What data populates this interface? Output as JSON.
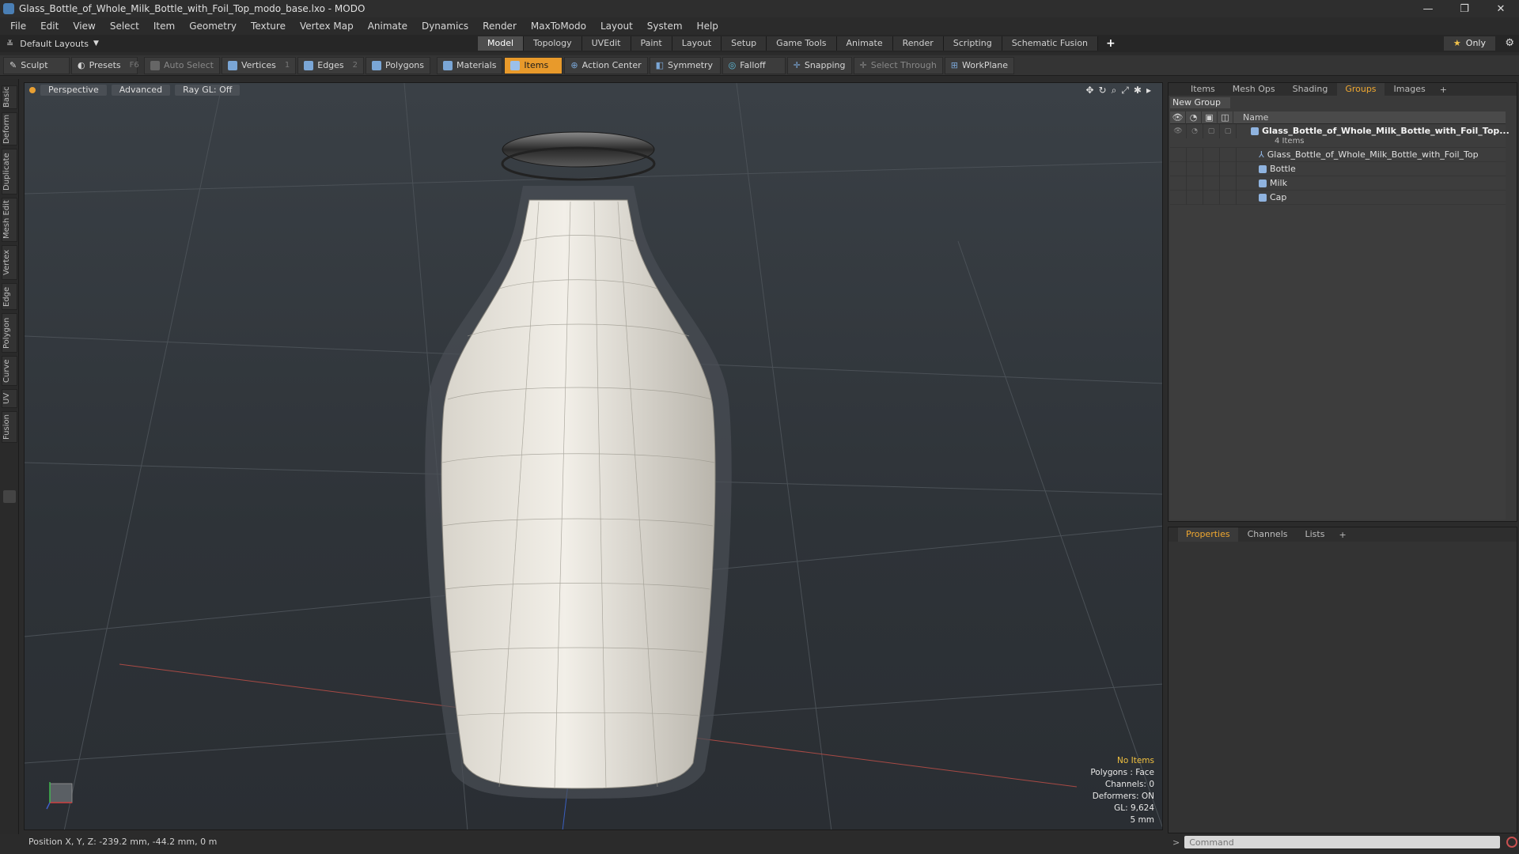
{
  "window": {
    "title": "Glass_Bottle_of_Whole_Milk_Bottle_with_Foil_Top_modo_base.lxo - MODO",
    "controls": [
      "—",
      "❐",
      "✕"
    ]
  },
  "menu": [
    "File",
    "Edit",
    "View",
    "Select",
    "Item",
    "Geometry",
    "Texture",
    "Vertex Map",
    "Animate",
    "Dynamics",
    "Render",
    "MaxToModo",
    "Layout",
    "System",
    "Help"
  ],
  "layout_bar": {
    "layout_select": "Default Layouts",
    "tabs": [
      "Model",
      "Topology",
      "UVEdit",
      "Paint",
      "Layout",
      "Setup",
      "Game Tools",
      "Animate",
      "Render",
      "Scripting",
      "Schematic Fusion"
    ],
    "active_tab": "Model",
    "only_label": "Only"
  },
  "toolbar": {
    "sculpt": "Sculpt",
    "presets": "Presets",
    "presets_key": "F6",
    "auto_select": "Auto Select",
    "vertices": "Vertices",
    "vertices_key": "1",
    "edges": "Edges",
    "edges_key": "2",
    "polygons": "Polygons",
    "materials": "Materials",
    "items": "Items",
    "action_center": "Action Center",
    "symmetry": "Symmetry",
    "falloff": "Falloff",
    "snapping": "Snapping",
    "select_through": "Select Through",
    "workplane": "WorkPlane"
  },
  "left_tabs": [
    "Basic",
    "Deform",
    "Duplicate",
    "Mesh Edit",
    "Vertex",
    "Edge",
    "Polygon",
    "Curve",
    "UV",
    "Fusion"
  ],
  "viewport": {
    "view": "Perspective",
    "shading": "Advanced",
    "raygl": "Ray GL: Off",
    "info": {
      "selection": "No Items",
      "polygons": "Polygons : Face",
      "channels": "Channels: 0",
      "deformers": "Deformers: ON",
      "gl": "GL: 9,624",
      "scale": "5 mm"
    }
  },
  "status": {
    "position": "Position X, Y, Z:  -239.2 mm, -44.2 mm, 0 m"
  },
  "groups_panel": {
    "tabs": [
      "Items",
      "Mesh Ops",
      "Shading",
      "Groups",
      "Images"
    ],
    "active_tab": "Groups",
    "new_group": "New Group",
    "name_header": "Name",
    "group_name": "Glass_Bottle_of_Whole_Milk_Bottle_with_Foil_Top...",
    "group_count": "4 Items",
    "children": [
      "Glass_Bottle_of_Whole_Milk_Bottle_with_Foil_Top",
      "Bottle",
      "Milk",
      "Cap"
    ]
  },
  "properties_panel": {
    "tabs": [
      "Properties",
      "Channels",
      "Lists"
    ],
    "active_tab": "Properties"
  },
  "command": {
    "placeholder": "Command"
  },
  "colors": {
    "accent": "#e89a2b",
    "active_tab_text": "#f0a830",
    "viewport_bg": "#343a3f",
    "milk": "#ece8df"
  }
}
